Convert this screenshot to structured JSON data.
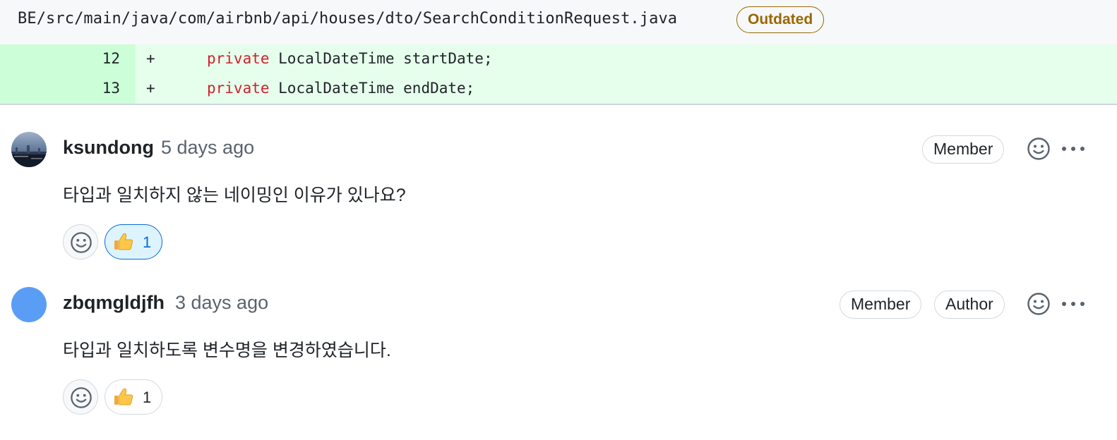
{
  "file": {
    "path": "BE/src/main/java/com/airbnb/api/houses/dto/SearchConditionRequest.java",
    "badge": "Outdated"
  },
  "diff": {
    "lines": [
      {
        "number": "12",
        "sign": "+",
        "keyword": "private",
        "rest": " LocalDateTime startDate;"
      },
      {
        "number": "13",
        "sign": "+",
        "keyword": "private",
        "rest": " LocalDateTime endDate;"
      }
    ]
  },
  "comments": [
    {
      "author": "ksundong",
      "time": "5 days ago",
      "badges": [
        "Member"
      ],
      "body": "타입과 일치하지 않는 네이밍인 이유가 있나요?",
      "reaction": {
        "emoji": "thumbs-up",
        "count": "1",
        "active": true
      }
    },
    {
      "author": "zbqmgldjfh",
      "time": "3 days ago",
      "badges": [
        "Member",
        "Author"
      ],
      "body": "타입과 일치하도록 변수명을 변경하였습니다.",
      "reaction": {
        "emoji": "thumbs-up",
        "count": "1",
        "active": false
      }
    }
  ],
  "icons": {
    "add_reaction": "smiley-icon",
    "more": "kebab-horizontal-icon",
    "reaction": "thumbs-up-icon"
  },
  "colors": {
    "outdated": "#9a6700",
    "diff_added_bg": "#e6ffec",
    "diff_added_gutter": "#ccffd8",
    "keyword": "#cf222e",
    "reaction_active_border": "#0969da",
    "reaction_active_bg": "#ddf4ff"
  }
}
